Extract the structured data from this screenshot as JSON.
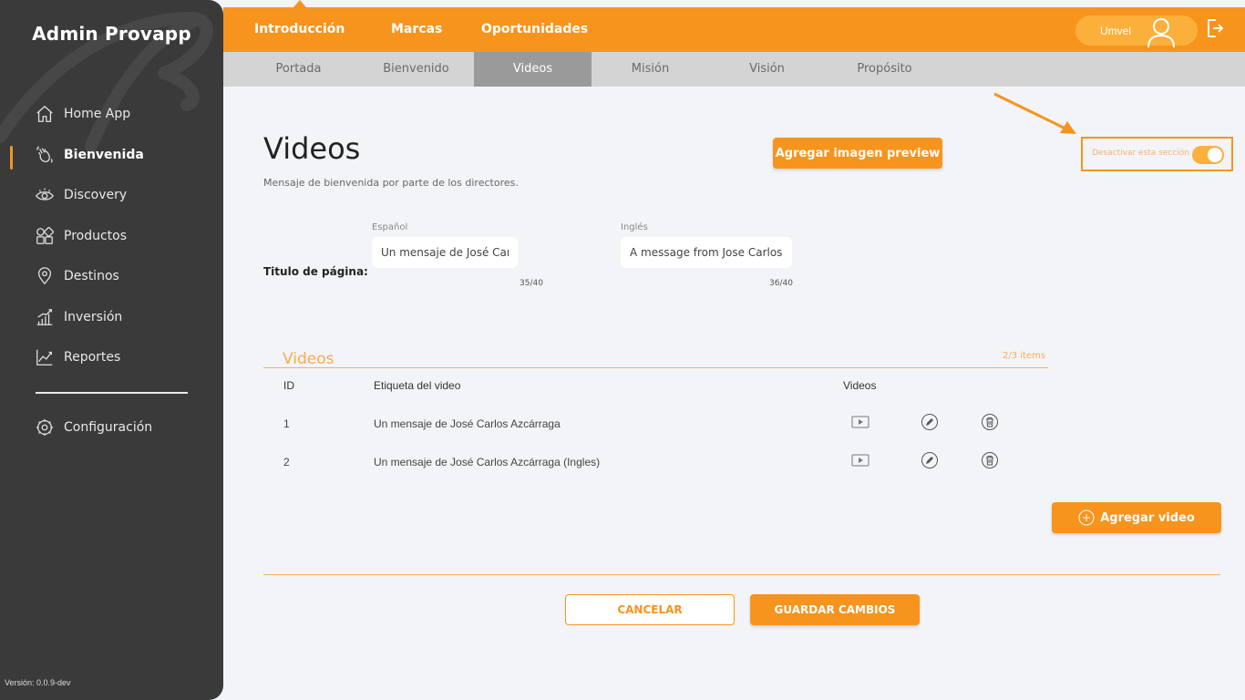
{
  "sidebar": {
    "brand": "Admin Provapp",
    "items": [
      {
        "label": "Home App",
        "icon": "home-icon"
      },
      {
        "label": "Bienvenida",
        "icon": "hand-wave-icon",
        "active": true
      },
      {
        "label": "Discovery",
        "icon": "eye-icon"
      },
      {
        "label": "Productos",
        "icon": "grid-icon"
      },
      {
        "label": "Destinos",
        "icon": "location-pin-icon"
      },
      {
        "label": "Inversión",
        "icon": "bar-growth-icon"
      },
      {
        "label": "Reportes",
        "icon": "line-chart-icon"
      }
    ],
    "settings": {
      "label": "Configuración",
      "icon": "gear-icon"
    },
    "version": "Versión: 0.0.9-dev"
  },
  "topbar": {
    "tabs": [
      "Introducción",
      "Marcas",
      "Oportunidades"
    ],
    "user": "Umvel",
    "accent": "#f7941d"
  },
  "subnav": {
    "tabs": [
      "Portada",
      "Bienvenido",
      "Videos",
      "Misión",
      "Visión",
      "Propósito"
    ],
    "active": "Videos"
  },
  "main": {
    "title": "Videos",
    "subtitle": "Mensaje de bienvenida por parte de los directores.",
    "preview_button": "Agregar imagen preview",
    "toggle_label": "Desactivar esta sección",
    "toggle_on": true,
    "page_title_label": "Titulo de página:",
    "spanish_label": "Español",
    "english_label": "Inglés",
    "spanish_value": "Un mensaje de José Carlos Az",
    "english_value": "A message from Jose Carlos A",
    "spanish_count": "35/40",
    "english_count": "36/40"
  },
  "videos": {
    "section_title": "Videos",
    "count_label": "2/3 items",
    "headers": {
      "id": "ID",
      "label": "Etiqueta del video",
      "videos": "Videos"
    },
    "rows": [
      {
        "id": "1",
        "label": "Un mensaje de José Carlos Azcárraga"
      },
      {
        "id": "2",
        "label": "Un mensaje de José Carlos Azcárraga (Ingles)"
      }
    ],
    "add_button": "Agregar video"
  },
  "footer": {
    "cancel": "CANCELAR",
    "save": "GUARDAR CAMBIOS"
  }
}
